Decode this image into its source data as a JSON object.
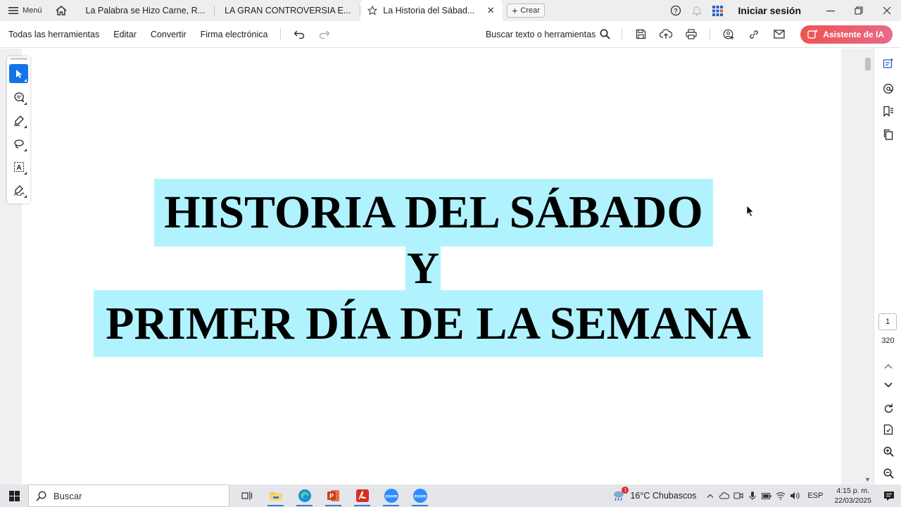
{
  "tabbar": {
    "menu_label": "Menú",
    "tabs": [
      {
        "label": "La Palabra se Hizo Carne, R..."
      },
      {
        "label": "LA GRAN CONTROVERSIA E..."
      },
      {
        "label": "La Historia del Sábad..."
      }
    ],
    "create_label": "Crear",
    "signin_label": "Iniciar sesión"
  },
  "toolbar": {
    "all_tools": "Todas las herramientas",
    "edit": "Editar",
    "convert": "Convertir",
    "esign": "Firma electrónica",
    "search_label": "Buscar texto o herramientas",
    "ai_label": "Asistente de IA"
  },
  "document": {
    "line1": "HISTORIA DEL SÁBADO",
    "line2": "Y",
    "line3": "PRIMER DÍA DE LA SEMANA"
  },
  "navigation": {
    "current_page": "1",
    "total_pages": "320"
  },
  "taskbar": {
    "search_placeholder": "Buscar",
    "weather": "16°C  Chubascos",
    "weather_badge": "1",
    "language": "ESP",
    "time": "4:15 p. m.",
    "date": "22/03/2025"
  },
  "colors": {
    "highlight": "#b0f3ff",
    "accent": "#1473e6",
    "ai_gradient_start": "#ef5350",
    "ai_gradient_end": "#e86a8a"
  }
}
